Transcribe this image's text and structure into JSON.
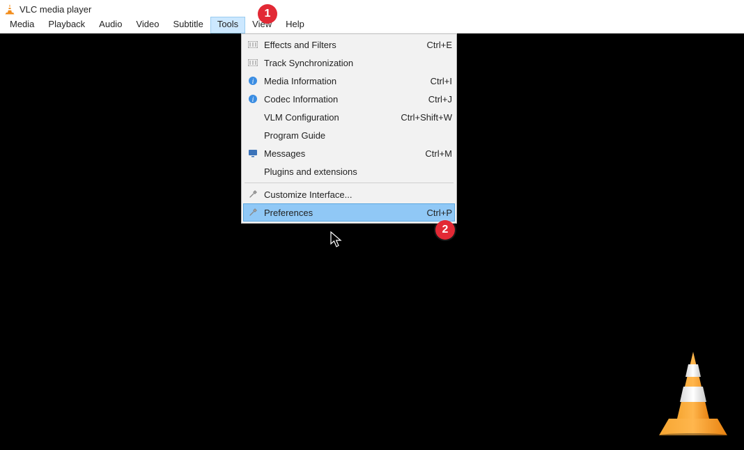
{
  "app": {
    "title": "VLC media player"
  },
  "menubar": {
    "items": [
      "Media",
      "Playback",
      "Audio",
      "Video",
      "Subtitle",
      "Tools",
      "View",
      "Help"
    ],
    "open_index": 5
  },
  "tools_menu": {
    "items": [
      {
        "icon": "sliders",
        "label": "Effects and Filters",
        "shortcut": "Ctrl+E"
      },
      {
        "icon": "sliders",
        "label": "Track Synchronization",
        "shortcut": ""
      },
      {
        "icon": "info",
        "label": "Media Information",
        "shortcut": "Ctrl+I"
      },
      {
        "icon": "info",
        "label": "Codec Information",
        "shortcut": "Ctrl+J"
      },
      {
        "icon": "",
        "label": "VLM Configuration",
        "shortcut": "Ctrl+Shift+W"
      },
      {
        "icon": "",
        "label": "Program Guide",
        "shortcut": ""
      },
      {
        "icon": "screen",
        "label": "Messages",
        "shortcut": "Ctrl+M"
      },
      {
        "icon": "",
        "label": "Plugins and extensions",
        "shortcut": ""
      },
      {
        "sep": true
      },
      {
        "icon": "wrench",
        "label": "Customize Interface...",
        "shortcut": ""
      },
      {
        "icon": "wrench",
        "label": "Preferences",
        "shortcut": "Ctrl+P",
        "highlight": true
      }
    ]
  },
  "annotations": {
    "a1": "1",
    "a2": "2"
  }
}
